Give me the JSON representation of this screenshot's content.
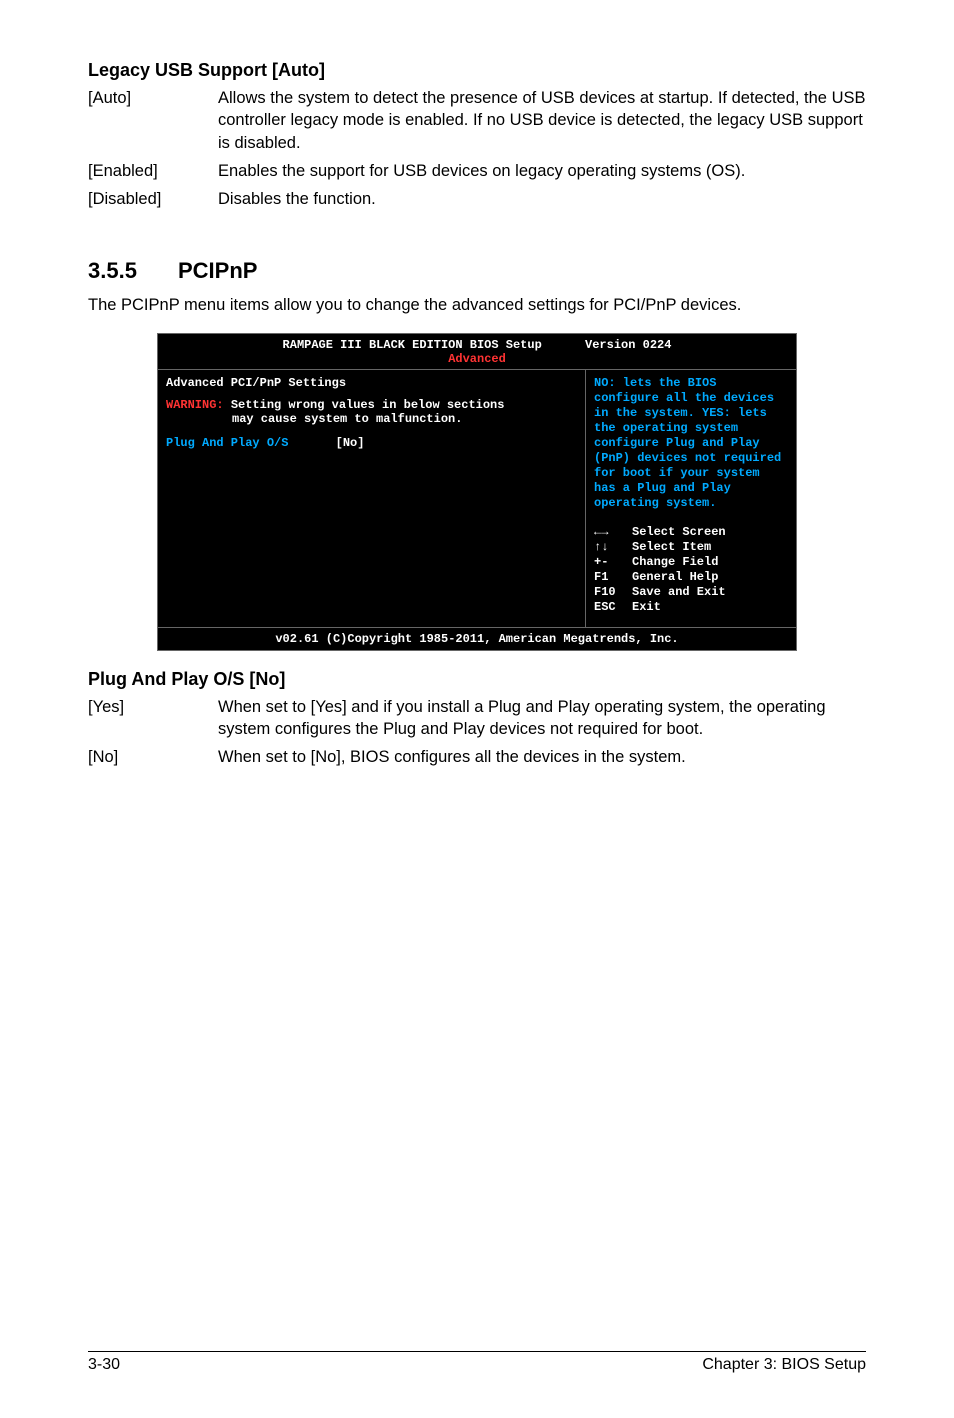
{
  "legacy": {
    "title": "Legacy USB Support [Auto]",
    "rows": [
      {
        "key": "[Auto]",
        "val": "Allows the system to detect the presence of USB devices at startup. If detected, the USB controller legacy mode is enabled. If no USB device is detected, the legacy USB support is disabled."
      },
      {
        "key": "[Enabled]",
        "val": "Enables the support for USB devices on legacy operating systems (OS)."
      },
      {
        "key": "[Disabled]",
        "val": "Disables the function."
      }
    ]
  },
  "pcipnp": {
    "num": "3.5.5",
    "title": "PCIPnP",
    "intro": "The PCIPnP menu items allow you to change the advanced settings for PCI/PnP devices."
  },
  "bios": {
    "title_left": "RAMPAGE III BLACK EDITION BIOS Setup",
    "title_right": "Version 0224",
    "tab": "Advanced",
    "left": {
      "heading": "Advanced PCI/PnP Settings",
      "warn_label": "WARNING:",
      "warn_text1": "Setting wrong values in below sections",
      "warn_text2": "may cause system to malfunction.",
      "item_label": "Plug And Play O/S",
      "item_value": "[No]"
    },
    "right": {
      "help": "NO: lets the BIOS configure all the devices in the system. YES: lets the operating system configure Plug and Play (PnP) devices not required for boot if your system has a Plug and Play operating system.",
      "nav": [
        {
          "k": "←→",
          "v": "Select Screen"
        },
        {
          "k": "↑↓",
          "v": "Select Item"
        },
        {
          "k": "+-",
          "v": "Change Field"
        },
        {
          "k": "F1",
          "v": "General Help"
        },
        {
          "k": "F10",
          "v": "Save and Exit"
        },
        {
          "k": "ESC",
          "v": "Exit"
        }
      ]
    },
    "footer": "v02.61 (C)Copyright 1985-2011, American Megatrends, Inc."
  },
  "plug": {
    "title": "Plug And Play O/S [No]",
    "rows": [
      {
        "key": "[Yes]",
        "val": "When set to [Yes] and if you install a Plug and Play operating system, the operating system configures the Plug and Play devices not required for boot."
      },
      {
        "key": "[No]",
        "val": "When set to [No], BIOS configures all the devices in the system."
      }
    ]
  },
  "footer": {
    "left": "3-30",
    "right": "Chapter 3: BIOS Setup"
  }
}
